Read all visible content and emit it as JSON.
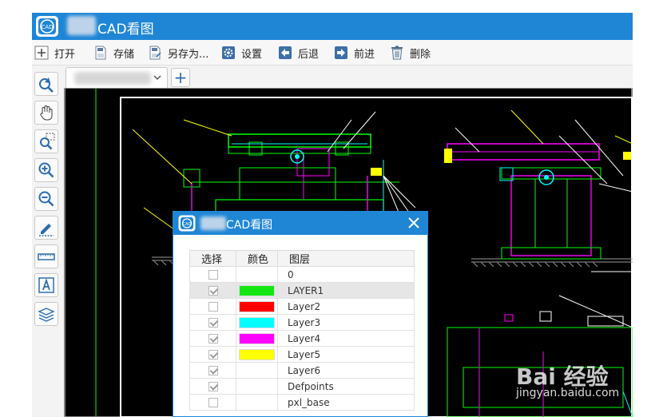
{
  "app": {
    "title": "CAD看图",
    "logo_text": "CAD",
    "accent": "#1f86d6"
  },
  "toolbar": {
    "open_label": "打开",
    "save_label": "存储",
    "saveas_label": "另存为...",
    "settings_label": "设置",
    "back_label": "后退",
    "forward_label": "前进",
    "delete_label": "删除"
  },
  "left_tools": [
    {
      "name": "rotate-icon"
    },
    {
      "name": "pan-hand-icon"
    },
    {
      "name": "zoom-window-icon"
    },
    {
      "name": "zoom-in-icon"
    },
    {
      "name": "zoom-out-icon"
    },
    {
      "name": "pencil-icon"
    },
    {
      "name": "measure-ruler-icon"
    },
    {
      "name": "text-icon"
    },
    {
      "name": "layers-icon"
    }
  ],
  "tabs": {
    "add_label": "+"
  },
  "layer_dialog": {
    "title": "CAD看图",
    "close_label": "✕",
    "columns": [
      "选择",
      "颜色",
      "图层"
    ],
    "layers": [
      {
        "name": "0",
        "checked": false,
        "color": ""
      },
      {
        "name": "LAYER1",
        "checked": true,
        "color": "#14e614",
        "selected": true
      },
      {
        "name": "Layer2",
        "checked": false,
        "color": "#ff0000"
      },
      {
        "name": "Layer3",
        "checked": true,
        "color": "#00ffff"
      },
      {
        "name": "Layer4",
        "checked": true,
        "color": "#ff00ff"
      },
      {
        "name": "Layer5",
        "checked": true,
        "color": "#ffff00"
      },
      {
        "name": "Layer6",
        "checked": true,
        "color": ""
      },
      {
        "name": "Defpoints",
        "checked": true,
        "color": ""
      },
      {
        "name": "pxl_base",
        "checked": false,
        "color": ""
      }
    ]
  },
  "watermark": {
    "text": "Bai 经验",
    "url": "jingyan.baidu.com"
  }
}
